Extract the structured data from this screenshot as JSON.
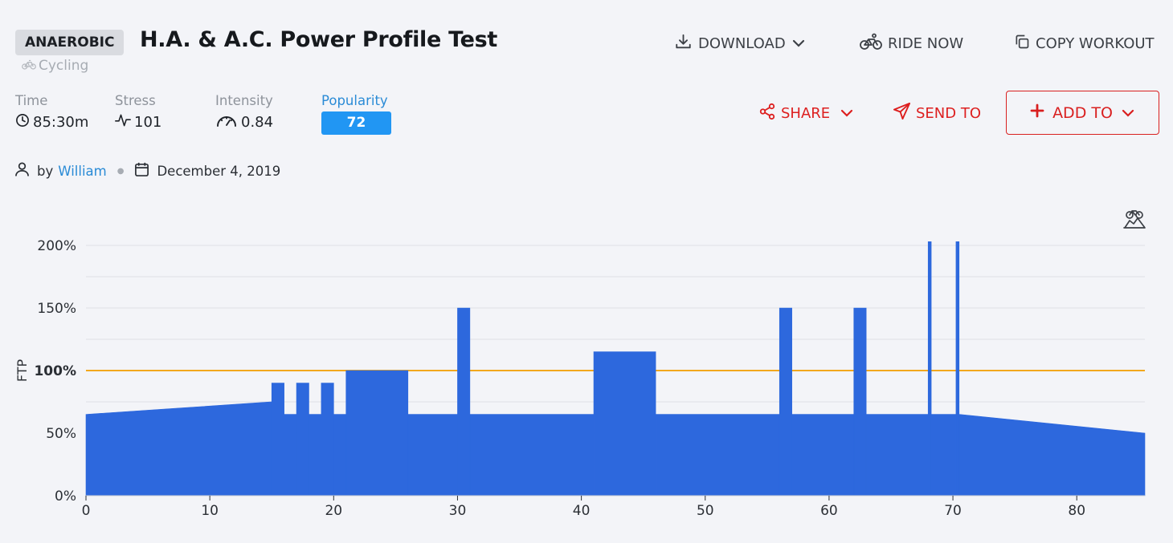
{
  "header": {
    "badge": "ANAEROBIC",
    "title": "H.A. & A.C. Power Profile Test",
    "sport": "Cycling"
  },
  "actions": {
    "download": "DOWNLOAD",
    "ride_now": "RIDE NOW",
    "copy_workout": "COPY WORKOUT",
    "share": "SHARE",
    "send_to": "SEND TO",
    "add_to": "ADD TO"
  },
  "stats": {
    "time_label": "Time",
    "time_value": "85:30m",
    "stress_label": "Stress",
    "stress_value": "101",
    "intensity_label": "Intensity",
    "intensity_value": "0.84",
    "popularity_label": "Popularity",
    "popularity_value": "72"
  },
  "meta": {
    "by": "by",
    "author": "William",
    "date": "December 4, 2019"
  },
  "colors": {
    "accent_red": "#d91f1f",
    "link_blue": "#2a8bd6",
    "popularity_blue": "#2196f3",
    "bar_blue": "#2d68dd",
    "ftp_line": "#f2a81d"
  },
  "icons": [
    "download-icon",
    "bike-icon",
    "copy-icon",
    "share-icon",
    "send-icon",
    "plus-icon",
    "clock-icon",
    "pulse-icon",
    "gauge-icon",
    "user-icon",
    "calendar-icon",
    "bike-elevation-icon"
  ],
  "chart_data": {
    "type": "area",
    "ylabel": "FTP",
    "xlim": [
      0,
      85.5
    ],
    "ylim": [
      0,
      200
    ],
    "yticks": [
      "0%",
      "50%",
      "100%",
      "150%",
      "200%"
    ],
    "xticks": [
      0,
      10,
      20,
      30,
      40,
      50,
      60,
      70,
      80
    ],
    "reference_line": {
      "value": 100,
      "label": "100%"
    },
    "grid": true,
    "segments": [
      {
        "start": 0,
        "end": 15,
        "from": 65,
        "to": 75
      },
      {
        "start": 15,
        "end": 16,
        "power": 90
      },
      {
        "start": 16,
        "end": 17,
        "power": 65
      },
      {
        "start": 17,
        "end": 18,
        "power": 90
      },
      {
        "start": 18,
        "end": 19,
        "power": 65
      },
      {
        "start": 19,
        "end": 20,
        "power": 90
      },
      {
        "start": 20,
        "end": 21,
        "power": 65
      },
      {
        "start": 21,
        "end": 26,
        "power": 100
      },
      {
        "start": 26,
        "end": 30,
        "power": 65
      },
      {
        "start": 30,
        "end": 31,
        "power": 150
      },
      {
        "start": 31,
        "end": 41,
        "power": 65
      },
      {
        "start": 41,
        "end": 46,
        "power": 115
      },
      {
        "start": 46,
        "end": 56,
        "power": 65
      },
      {
        "start": 56,
        "end": 57,
        "power": 150
      },
      {
        "start": 57,
        "end": 62,
        "power": 65
      },
      {
        "start": 62,
        "end": 63,
        "power": 150
      },
      {
        "start": 63,
        "end": 68,
        "power": 65
      },
      {
        "start": 68,
        "end": 68.25,
        "power": 203
      },
      {
        "start": 68.25,
        "end": 70.25,
        "power": 65
      },
      {
        "start": 70.25,
        "end": 70.5,
        "power": 203
      },
      {
        "start": 70.5,
        "end": 85.5,
        "from": 65,
        "to": 50
      }
    ]
  }
}
